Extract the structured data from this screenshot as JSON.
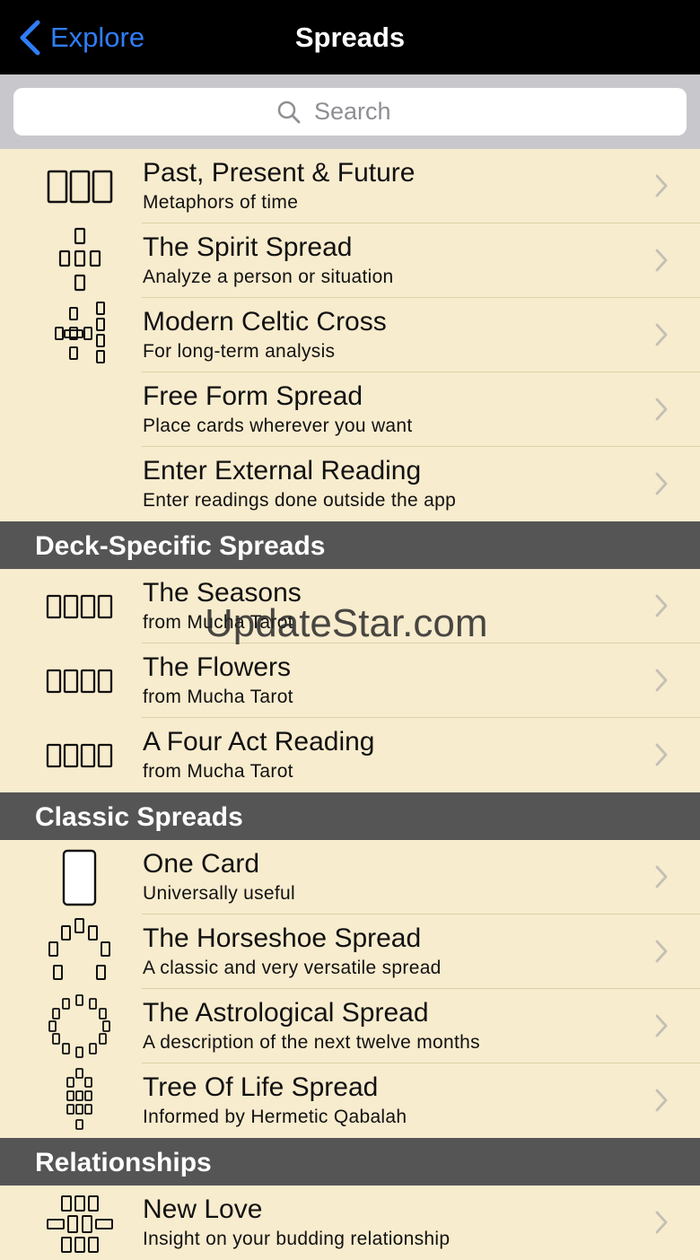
{
  "nav": {
    "back_label": "Explore",
    "title": "Spreads"
  },
  "search": {
    "placeholder": "Search"
  },
  "watermark": "UpdateStar.com",
  "rows": [
    {
      "title": "Past, Present & Future",
      "subtitle": "Metaphors of time"
    },
    {
      "title": "The Spirit Spread",
      "subtitle": "Analyze a person or situation"
    },
    {
      "title": "Modern Celtic Cross",
      "subtitle": "For long-term analysis"
    },
    {
      "title": "Free Form Spread",
      "subtitle": "Place cards wherever you want"
    },
    {
      "title": "Enter External Reading",
      "subtitle": "Enter readings done outside the app"
    },
    {
      "title": "The Seasons",
      "subtitle": "from Mucha Tarot"
    },
    {
      "title": "The Flowers",
      "subtitle": "from Mucha Tarot"
    },
    {
      "title": "A Four Act Reading",
      "subtitle": "from Mucha Tarot"
    },
    {
      "title": "One Card",
      "subtitle": "Universally useful"
    },
    {
      "title": "The Horseshoe Spread",
      "subtitle": "A classic and very versatile spread"
    },
    {
      "title": "The Astrological Spread",
      "subtitle": "A description of the next twelve months"
    },
    {
      "title": "Tree Of Life Spread",
      "subtitle": "Informed by Hermetic Qabalah"
    },
    {
      "title": "New Love",
      "subtitle": "Insight on your budding relationship"
    }
  ],
  "sections": [
    {
      "title": "Deck-Specific Spreads"
    },
    {
      "title": "Classic Spreads"
    },
    {
      "title": "Relationships"
    }
  ]
}
